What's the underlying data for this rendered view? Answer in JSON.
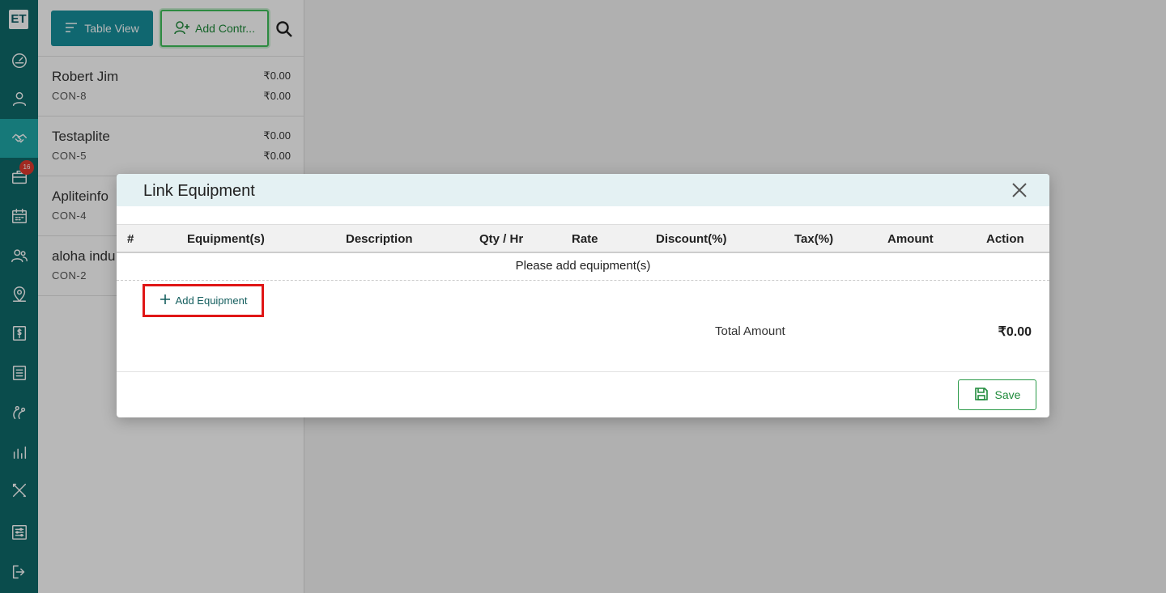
{
  "app": {
    "logo": "ET"
  },
  "sidebar": {
    "notification_count": "16"
  },
  "toolbar": {
    "table_view_label": "Table View",
    "add_contract_label": "Add Contr..."
  },
  "contacts": [
    {
      "name": "Robert Jim",
      "code": "CON-8",
      "amount1": "₹0.00",
      "amount2": "₹0.00"
    },
    {
      "name": "Testaplite",
      "code": "CON-5",
      "amount1": "₹0.00",
      "amount2": "₹0.00"
    },
    {
      "name": "Apliteinfo",
      "code": "CON-4"
    },
    {
      "name": "aloha indu",
      "code": "CON-2"
    }
  ],
  "modal": {
    "title": "Link Equipment",
    "columns": [
      "#",
      "Equipment(s)",
      "Description",
      "Qty / Hr",
      "Rate",
      "Discount(%)",
      "Tax(%)",
      "Amount",
      "Action"
    ],
    "empty_message": "Please add equipment(s)",
    "add_equipment_label": "Add Equipment",
    "total_label": "Total Amount",
    "total_value": "₹0.00",
    "save_label": "Save"
  }
}
